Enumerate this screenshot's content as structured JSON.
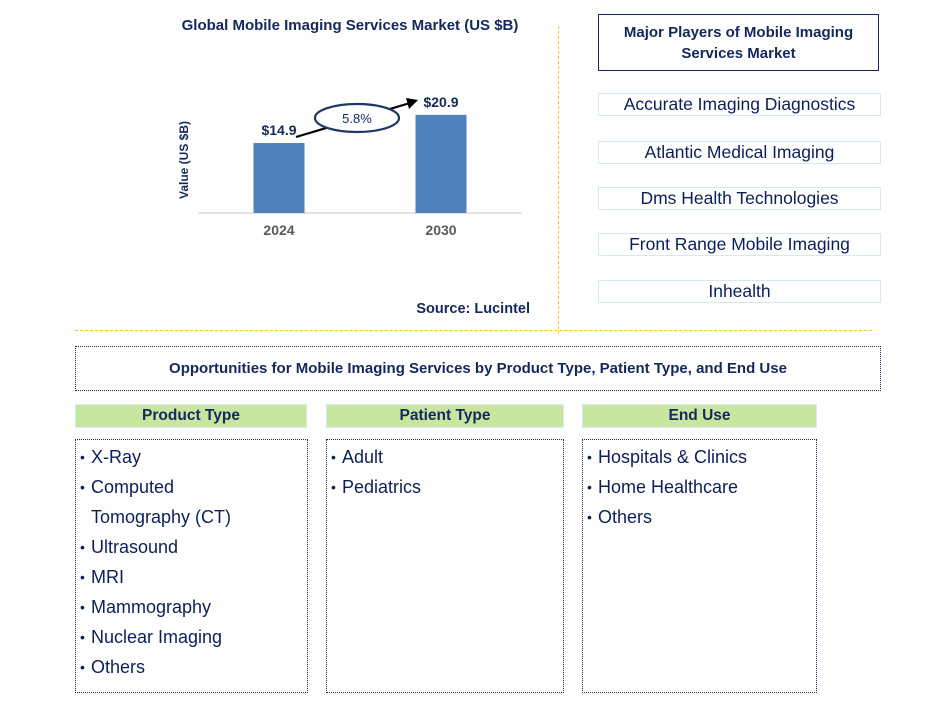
{
  "chart_data": {
    "type": "bar",
    "title": "Global Mobile Imaging Services Market (US $B)",
    "xlabel": "",
    "ylabel": "Value (US $B)",
    "categories": [
      "2024",
      "2030"
    ],
    "values": [
      14.9,
      20.9
    ],
    "data_labels": [
      "$14.9",
      "$20.9"
    ],
    "ylim": [
      0,
      23
    ],
    "grid": false,
    "bar_color": "#4f81bd",
    "annotation": {
      "type": "cagr-arrow",
      "label": "5.8%",
      "from": "2024",
      "to": "2030"
    },
    "source": "Source: Lucintel"
  },
  "players": {
    "title": "Major Players of Mobile Imaging Services Market",
    "items": [
      "Accurate Imaging Diagnostics",
      "Atlantic Medical Imaging",
      "Dms Health Technologies",
      "Front Range Mobile Imaging",
      "Inhealth"
    ]
  },
  "opportunities": {
    "title": "Opportunities for Mobile Imaging Services by Product Type, Patient Type, and End Use",
    "categories": [
      {
        "header": "Product Type",
        "items": [
          "X-Ray",
          "Computed Tomography (CT)",
          "Ultrasound",
          "MRI",
          "Mammography",
          "Nuclear Imaging",
          "Others"
        ]
      },
      {
        "header": "Patient Type",
        "items": [
          "Adult",
          "Pediatrics"
        ]
      },
      {
        "header": "End Use",
        "items": [
          "Hospitals & Clinics",
          "Home Healthcare",
          "Others"
        ]
      }
    ]
  },
  "colors": {
    "title_text": "#13285f",
    "bar": "#4f81bd",
    "divider": "#f5c518",
    "category_header_bg": "#c8e6a0",
    "player_border": "#d6e8f2"
  }
}
